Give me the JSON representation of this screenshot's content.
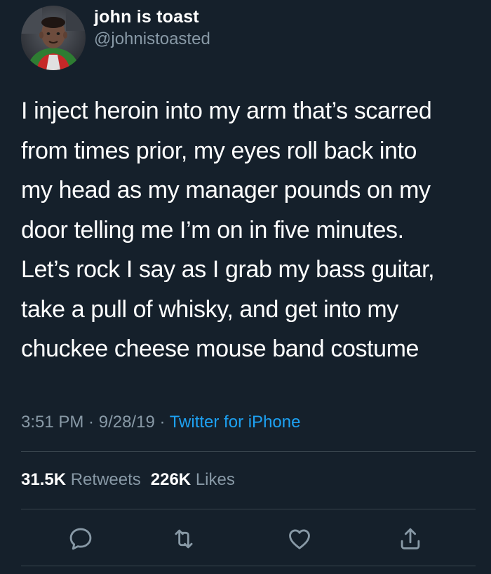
{
  "user": {
    "display_name": "john is toast",
    "handle": "@johnistoasted"
  },
  "tweet": {
    "lines": [
      "I inject heroin into my arm that’s scarred",
      "from times prior, my eyes roll back into",
      "my head as my manager pounds on my",
      "door telling me I’m on in five minutes.",
      "Let’s rock I say as I grab my bass guitar,",
      "take a pull of whisky, and get into my",
      "chuckee cheese mouse band costume"
    ]
  },
  "meta": {
    "time": "3:51 PM",
    "separator": " · ",
    "date": "9/28/19",
    "source": "Twitter for iPhone"
  },
  "stats": {
    "retweets_count": "31.5K",
    "retweets_label": "Retweets",
    "likes_count": "226K",
    "likes_label": "Likes"
  },
  "icons": {
    "reply": "reply-icon",
    "retweet": "retweet-icon",
    "like": "heart-icon",
    "share": "share-icon"
  },
  "colors": {
    "background": "#15202b",
    "text": "#ffffff",
    "secondary": "#8899a6",
    "accent": "#1da1f2",
    "divider": "#38444d"
  }
}
